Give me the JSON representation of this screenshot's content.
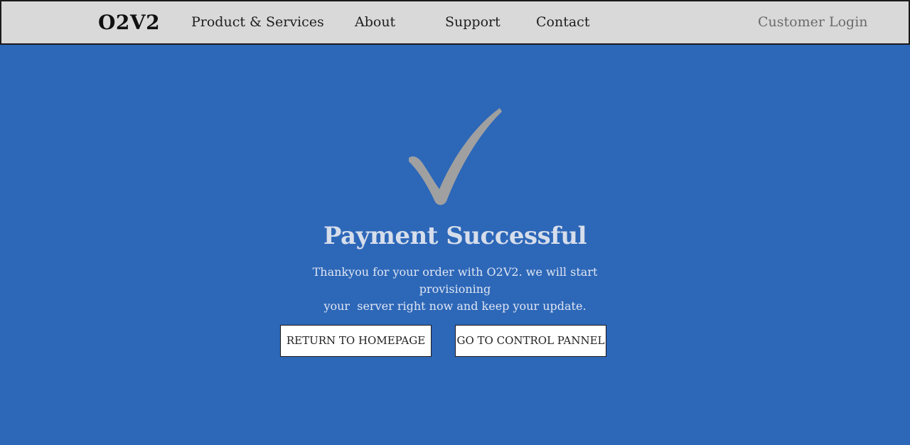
{
  "header": {
    "logo": "O2V2",
    "nav_items": [
      "Product & Services",
      "About",
      "Support",
      "Contact"
    ],
    "customer_login": "Customer Login"
  },
  "main": {
    "icon": "check-icon",
    "title": "Payment Successful",
    "message_line1": "Thankyou for your order with O2V2. we will start provisioning",
    "message_line2": "your  server right now and keep your update.",
    "buttons": {
      "return_home": "RETURN TO HOMEPAGE",
      "control_panel": "GO TO CONTROL PANNEL"
    }
  },
  "colors": {
    "background": "#2d67b8",
    "navbar": "#d9d9d9",
    "check": "#a0a0a0",
    "title": "#d6deeb"
  }
}
